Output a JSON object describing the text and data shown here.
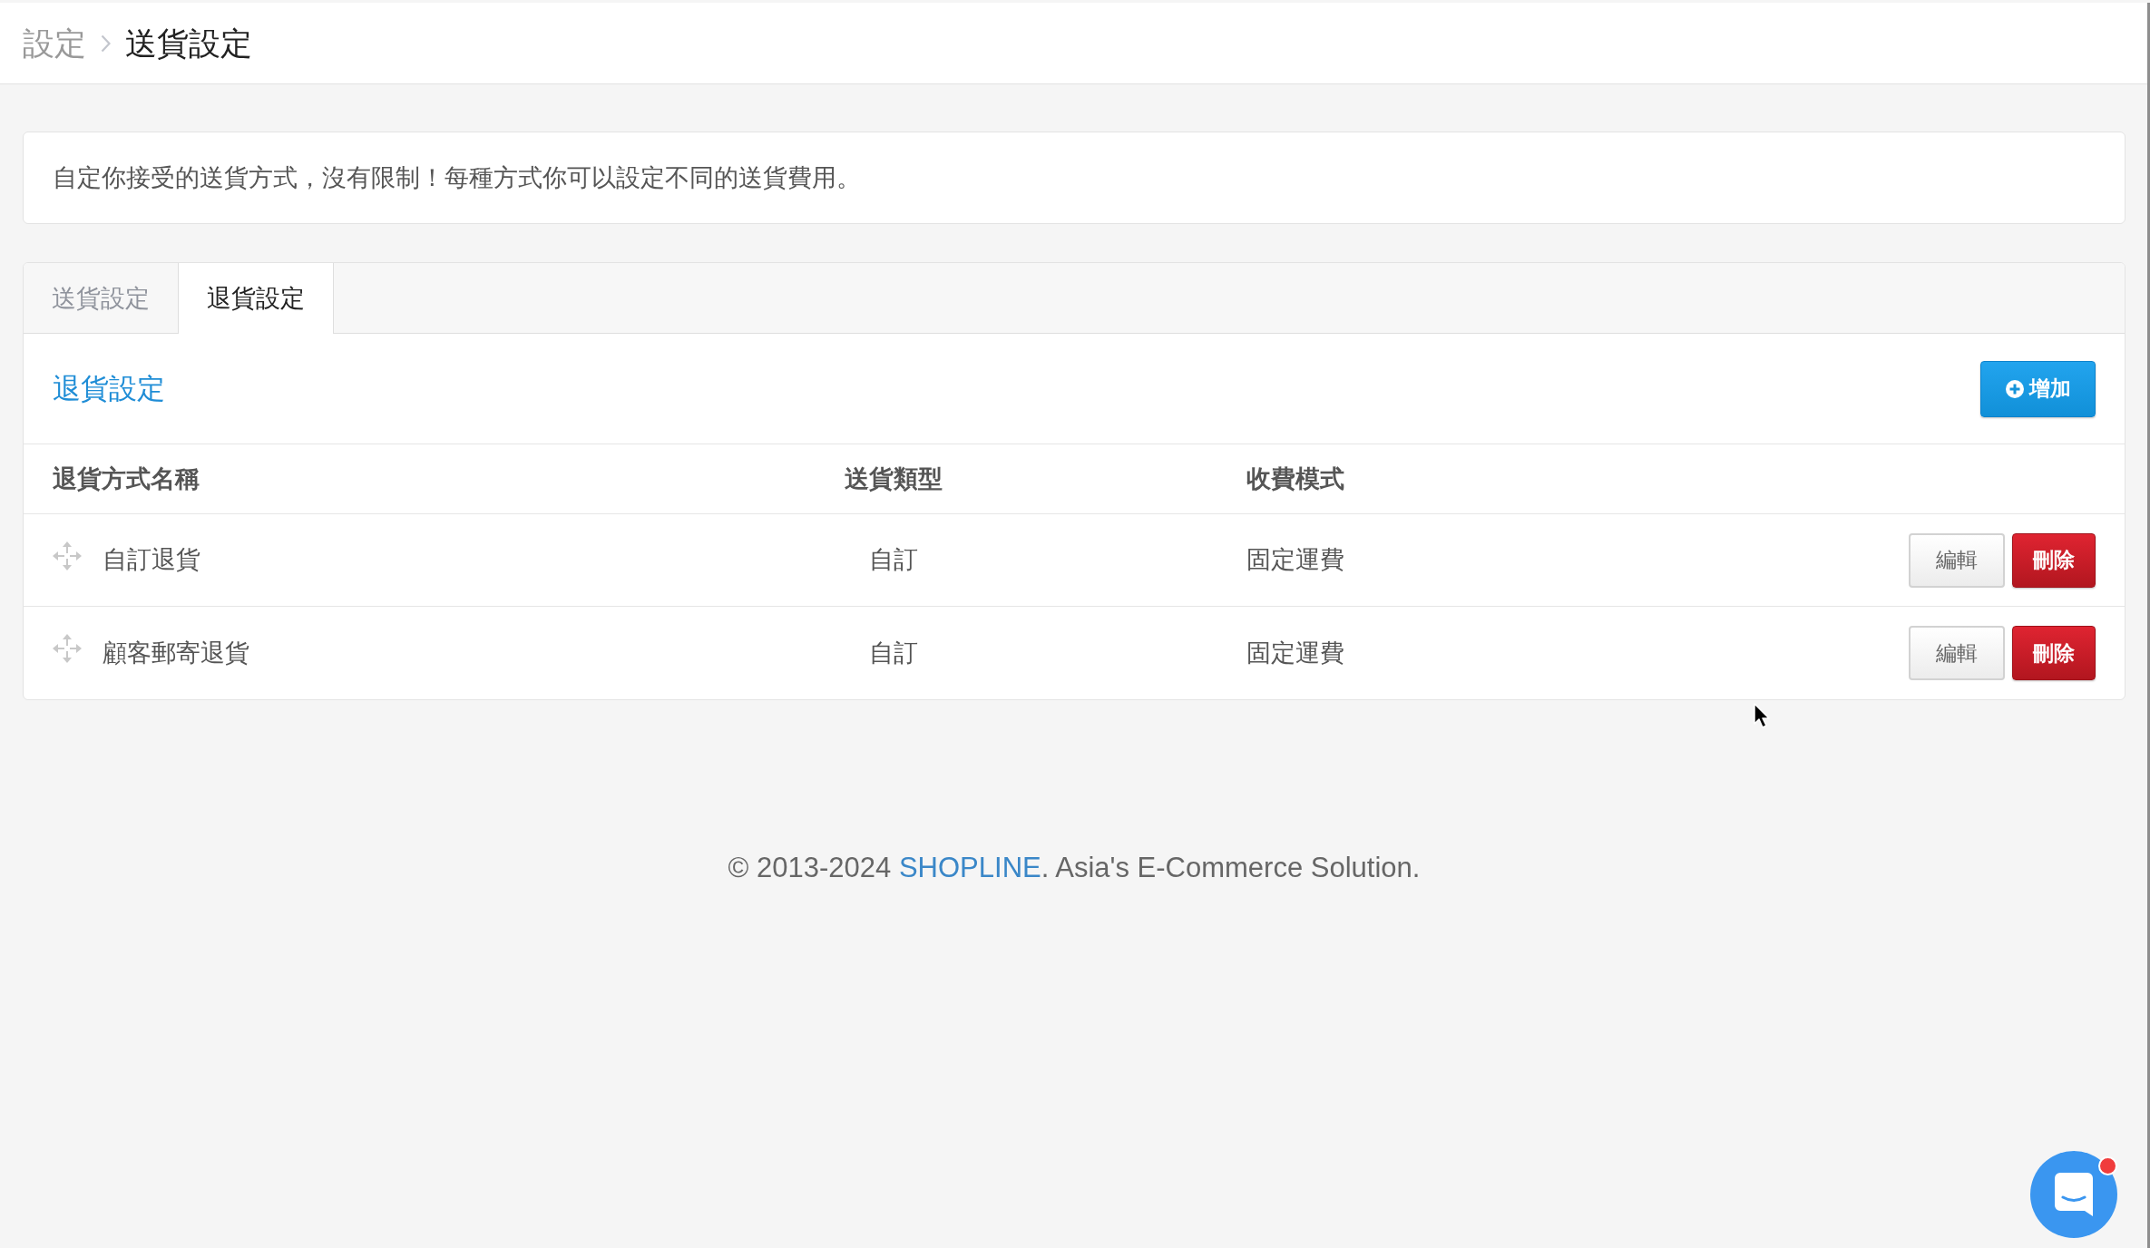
{
  "breadcrumb": [
    {
      "label": "設定",
      "current": false
    },
    {
      "label": "送貨設定",
      "current": true
    }
  ],
  "notice": {
    "text": "自定你接受的送貨方式，沒有限制！每種方式你可以設定不同的送貨費用。"
  },
  "tabs": [
    {
      "label": "送貨設定",
      "selected": false
    },
    {
      "label": "退貨設定",
      "selected": true
    }
  ],
  "section": {
    "title": "退貨設定",
    "add_button": "增加"
  },
  "table": {
    "columns": [
      "退貨方式名稱",
      "送貨類型",
      "收費模式"
    ],
    "rows": [
      {
        "name": "自訂退貨",
        "delivery_type": "自訂",
        "fee_mode": "固定運費",
        "actions": [
          {
            "kind": "edit",
            "label": "編輯"
          },
          {
            "kind": "delete",
            "label": "刪除"
          }
        ]
      },
      {
        "name": "顧客郵寄退貨",
        "delivery_type": "自訂",
        "fee_mode": "固定運費",
        "actions": [
          {
            "kind": "edit",
            "label": "編輯"
          },
          {
            "kind": "delete",
            "label": "刪除"
          }
        ]
      }
    ]
  },
  "footer": {
    "text_before": "© 2013-2024 ",
    "link": "SHOPLINE",
    "text_after": ". Asia's E-Commerce Solution."
  },
  "chat_widget": {
    "unread": true
  }
}
